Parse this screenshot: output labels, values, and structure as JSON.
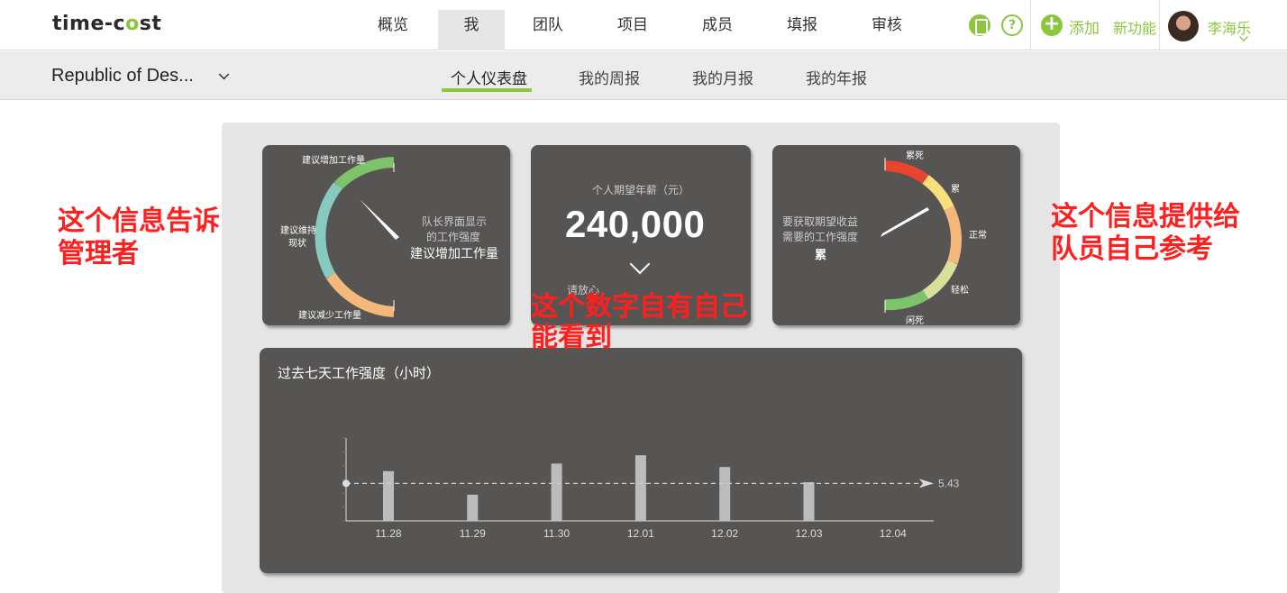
{
  "app": {
    "logo_left": "time-",
    "logo_mid": "c",
    "logo_dot": "o",
    "logo_right": "st"
  },
  "nav": {
    "items": [
      {
        "label": "概览"
      },
      {
        "label": "我"
      },
      {
        "label": "团队"
      },
      {
        "label": "项目"
      },
      {
        "label": "成员"
      },
      {
        "label": "填报"
      },
      {
        "label": "审核"
      }
    ],
    "help_symbol": "?",
    "add_label": "添加",
    "new_feature_label": "新功能",
    "user_name": "李海乐"
  },
  "subnav": {
    "org_name": "Republic of Des...",
    "tabs": [
      {
        "label": "个人仪表盘"
      },
      {
        "label": "我的周报"
      },
      {
        "label": "我的月报"
      },
      {
        "label": "我的年报"
      }
    ]
  },
  "gauge_team": {
    "label_top": "建议增加工作量",
    "label_left_1": "建议维持",
    "label_left_2": "现状",
    "label_bottom": "建议减少工作量",
    "caption_1": "队长界面显示",
    "caption_2": "的工作强度",
    "value": "建议增加工作量"
  },
  "salary_card": {
    "title": "个人期望年薪（元）",
    "value": "240,000",
    "footer_partial": "请放心"
  },
  "gauge_self": {
    "zones": [
      "累死",
      "累",
      "正常",
      "轻松",
      "闲死"
    ],
    "caption_1": "要获取期望收益",
    "caption_2": "需要的工作强度",
    "value": "累"
  },
  "annotations": {
    "manager_1": "这个信息告诉",
    "manager_2": "管理者",
    "self_only_1": "这个数字自有自己",
    "self_only_2": "能看到",
    "member_1": "这个信息提供给",
    "member_2": "队员自己参考"
  },
  "chart_data": {
    "type": "bar",
    "title": "过去七天工作强度（小时）",
    "categories": [
      "11.28",
      "11.29",
      "11.30",
      "12.01",
      "12.02",
      "12.03",
      "12.04"
    ],
    "values": [
      7.2,
      3.8,
      8.3,
      9.5,
      7.8,
      5.6,
      0
    ],
    "reference_line": 5.43,
    "reference_label": "5.43",
    "ylim": [
      0,
      12
    ],
    "colors": {
      "bar": "#bcbcbc",
      "background": "#575553",
      "axis": "#dddddd"
    }
  },
  "colors": {
    "accent": "#8cc63f",
    "annotation": "#ff1f1f",
    "gauge_green": "#7dc36b",
    "gauge_teal": "#86c9bf",
    "gauge_orange": "#f4b87a",
    "gauge_red": "#e8452f",
    "gauge_yellow": "#f7e07a"
  }
}
